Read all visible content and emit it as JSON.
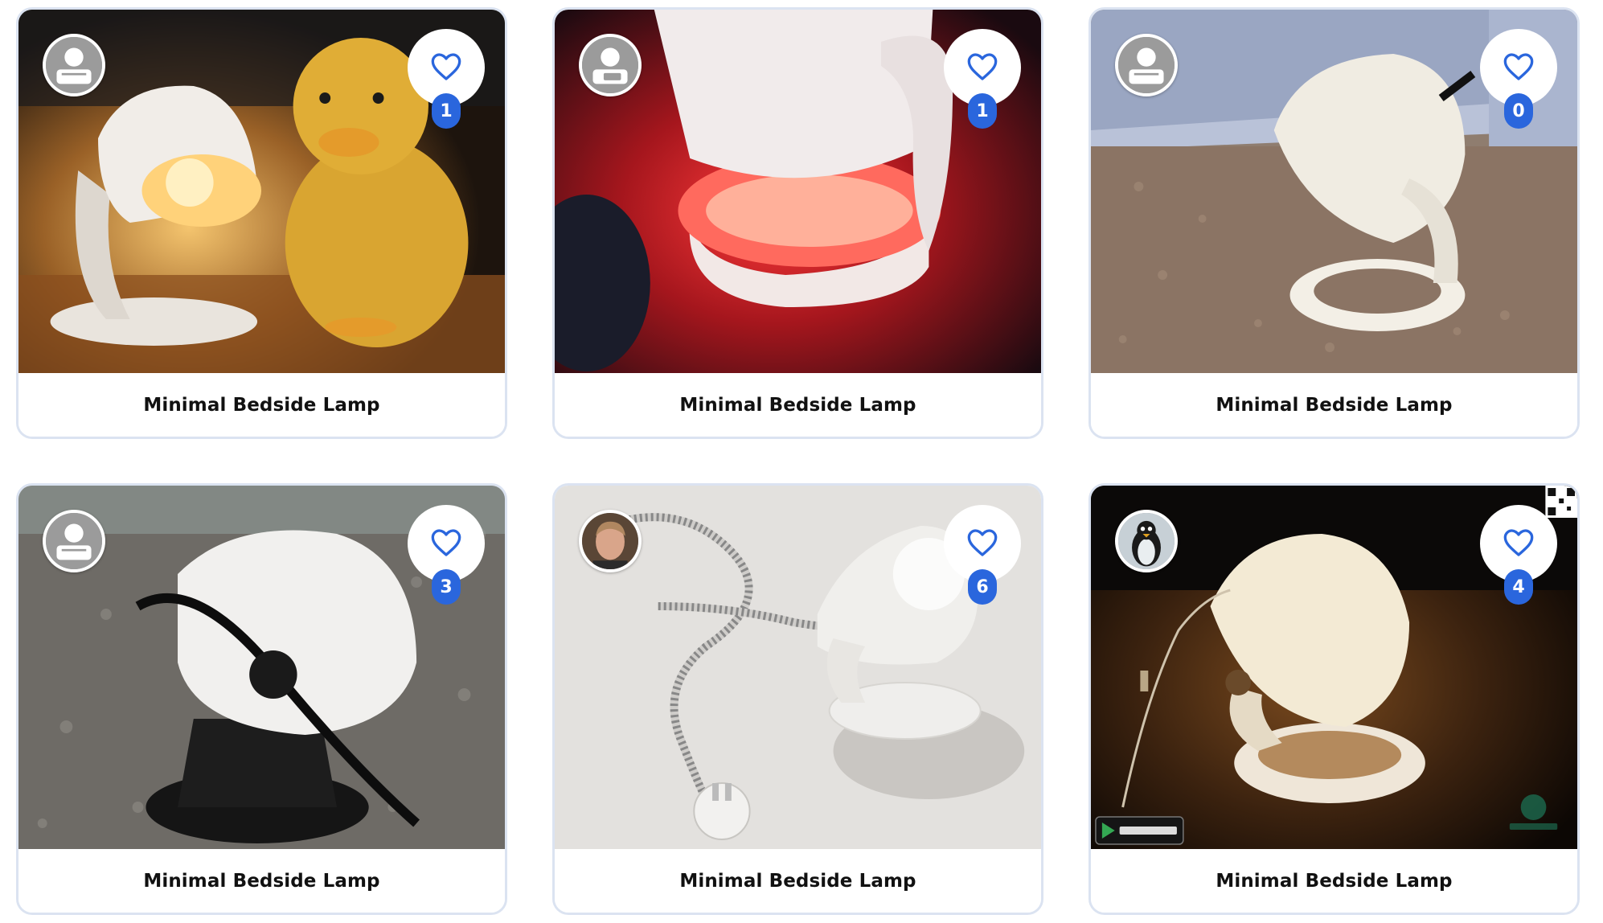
{
  "colors": {
    "accent": "#2a66dd",
    "card_border": "#dbe3f1",
    "heart": "#2a66dd"
  },
  "cards": [
    {
      "title": "Minimal Bedside Lamp",
      "likes": "1",
      "avatar": "default-user-avatar",
      "photo": "lamp-with-crochet-duck"
    },
    {
      "title": "Minimal Bedside Lamp",
      "likes": "1",
      "avatar": "default-user-avatar",
      "photo": "lamp-red-glow-closeup"
    },
    {
      "title": "Minimal Bedside Lamp",
      "likes": "0",
      "avatar": "default-user-avatar",
      "photo": "lamp-on-carpet"
    },
    {
      "title": "Minimal Bedside Lamp",
      "likes": "3",
      "avatar": "default-user-avatar",
      "photo": "lamp-black-base-granite"
    },
    {
      "title": "Minimal Bedside Lamp",
      "likes": "6",
      "avatar": "user-photo-avatar",
      "photo": "lamp-with-braided-cable"
    },
    {
      "title": "Minimal Bedside Lamp",
      "likes": "4",
      "avatar": "penguin-avatar",
      "photo": "lamp-on-wood-table"
    }
  ]
}
